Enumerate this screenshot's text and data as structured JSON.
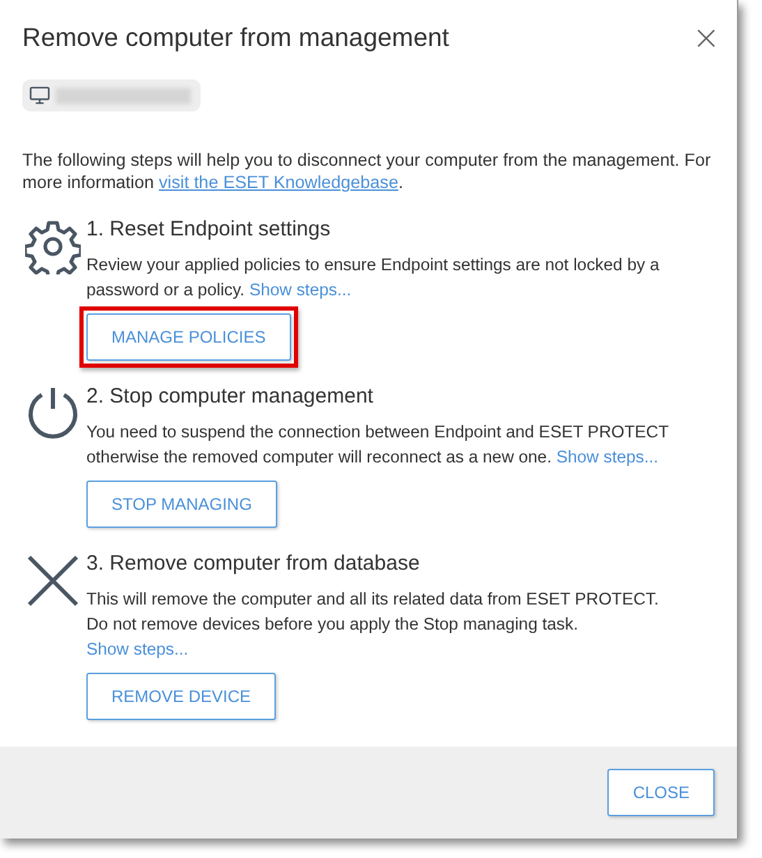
{
  "dialog": {
    "title": "Remove computer from management",
    "close_icon": "×"
  },
  "intro": {
    "text": "The following steps will help you to disconnect your computer from the management. For more information ",
    "link": "visit the ESET Knowledgebase",
    "after": "."
  },
  "steps": [
    {
      "kind": "gear",
      "title": "1. Reset Endpoint settings",
      "text": "Review your applied policies to ensure Endpoint settings are not locked by a password or a policy. ",
      "link": "Show steps...",
      "button": "MANAGE POLICIES",
      "highlighted": true
    },
    {
      "kind": "power",
      "title": "2. Stop computer management",
      "text": "You need to suspend the connection between Endpoint and ESET PROTECT otherwise the removed computer will reconnect as a new one. ",
      "link": "Show steps...",
      "button": "STOP MANAGING",
      "highlighted": false
    },
    {
      "kind": "cross",
      "title": "3. Remove computer from database",
      "text": "This will remove the computer and all its related data from ESET PROTECT. Do not remove devices before you apply the Stop managing task. ",
      "link": "Show steps...",
      "button": "REMOVE DEVICE",
      "highlighted": false
    }
  ],
  "footer": {
    "button": "CLOSE"
  }
}
